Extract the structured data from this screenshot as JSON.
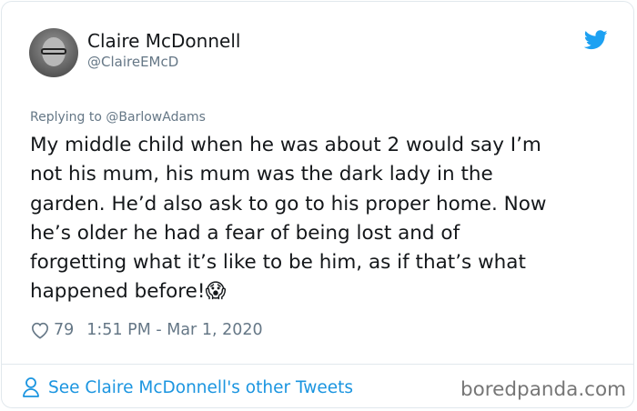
{
  "author": {
    "name": "Claire McDonnell",
    "handle": "@ClaireEMcD"
  },
  "reply": {
    "prefix": "Replying to",
    "user": "@BarlowAdams"
  },
  "tweet": {
    "text": "My middle child when he was about 2 would say I’m\nnot his mum, his mum was the dark lady in the\ngarden. He’d also ask to go to his proper home. Now\nhe’s older he had a fear of being lost and of\nforgetting what it’s like to be him, as if that’s what\nhappened before!",
    "emoji": "😱",
    "likes": "79",
    "timestamp": "1:51 PM - Mar 1, 2020"
  },
  "footer": {
    "see_more": "See Claire McDonnell's other Tweets",
    "watermark": "boredpanda.com"
  },
  "icons": {
    "platform": "twitter-bird-icon",
    "like": "heart-icon",
    "profile": "person-icon"
  },
  "colors": {
    "link": "#1b95e0",
    "secondary_text": "#657786",
    "primary_text": "#14171a",
    "twitter_blue": "#1da1f2"
  }
}
